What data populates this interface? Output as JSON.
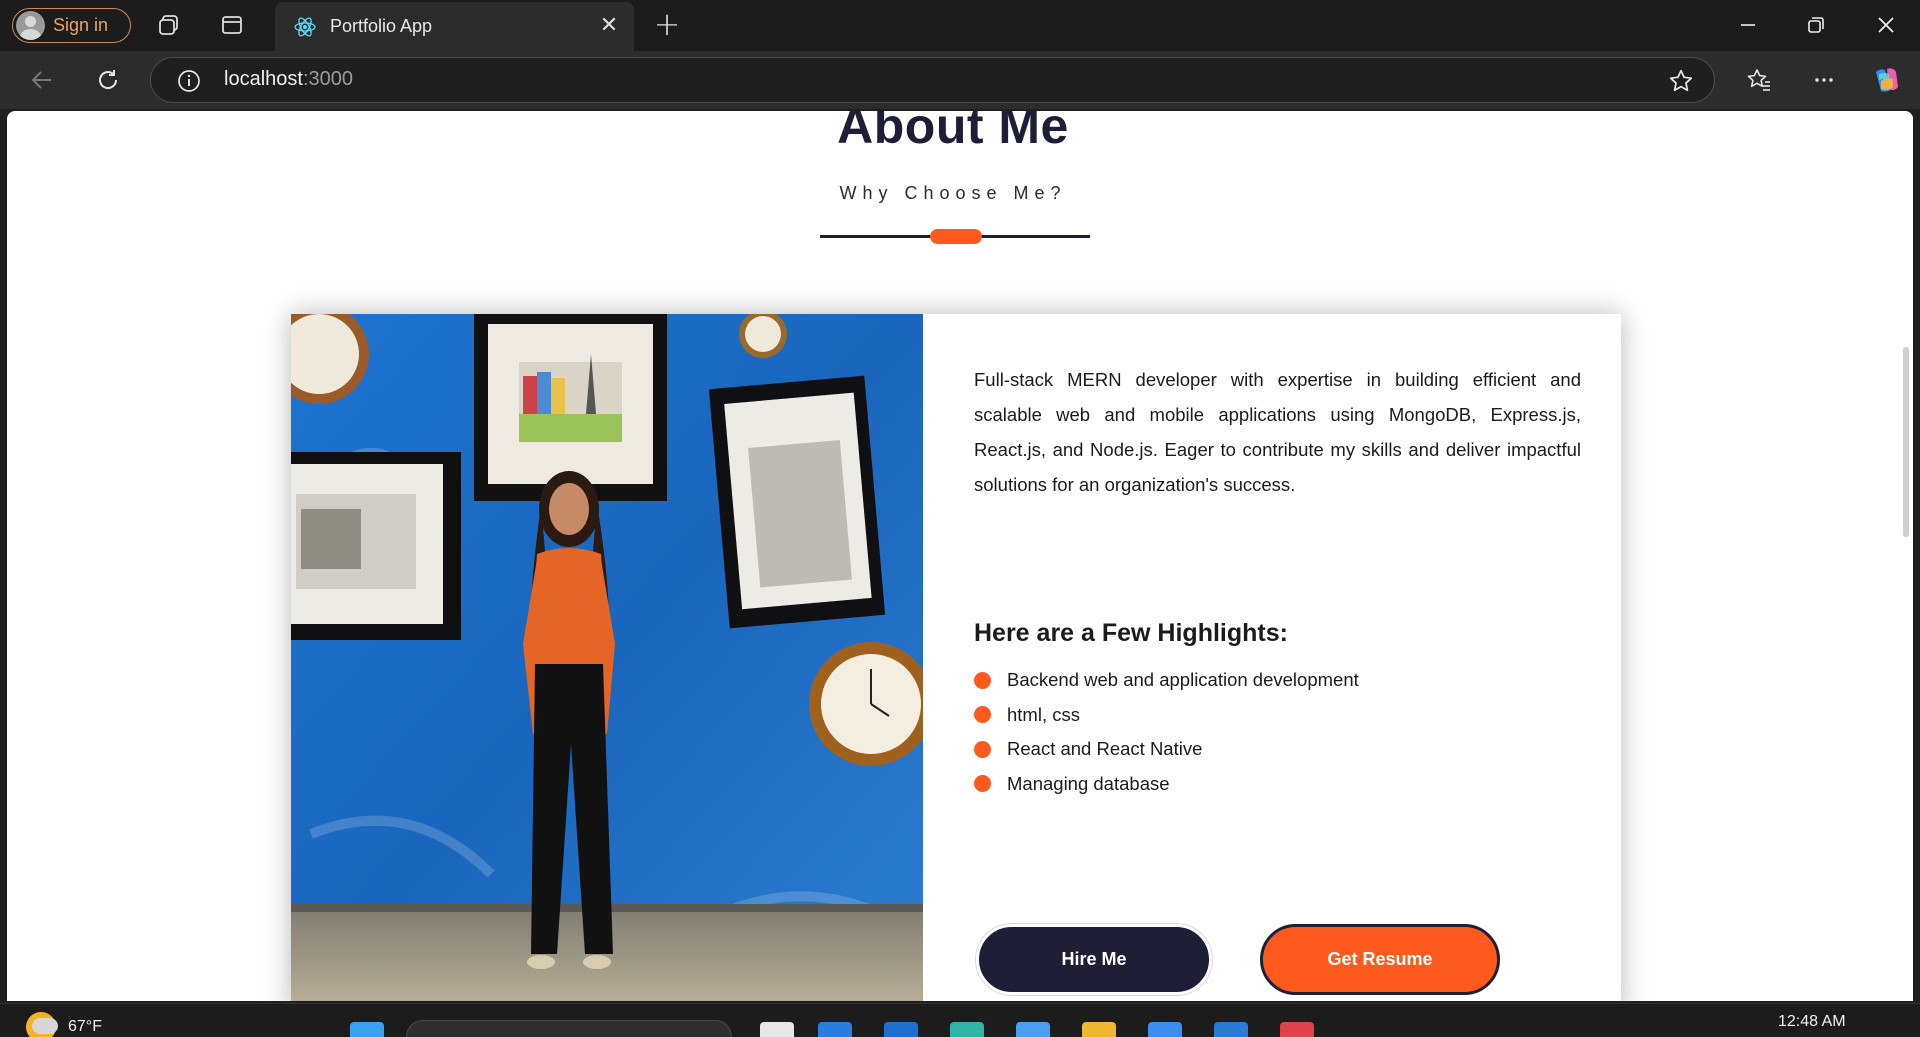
{
  "browser": {
    "signin_label": "Sign in",
    "tab_title": "Portfolio App",
    "url_host": "localhost",
    "url_port": ":3000"
  },
  "page": {
    "title": "About Me",
    "subtitle": "Why Choose Me?",
    "bio": "Full-stack MERN developer with expertise in building efficient and scalable web and mobile applications using MongoDB, Express.js, React.js, and Node.js. Eager to contribute my skills and deliver impactful solutions for an organization's success.",
    "highlights_title": "Here are a Few Highlights:",
    "highlights": [
      "Backend web and application development",
      "html, css",
      "React and React Native",
      "Managing database"
    ],
    "hire_button": "Hire Me",
    "resume_button": "Get Resume"
  },
  "taskbar": {
    "temperature": "67°F",
    "time": "12:48 AM"
  },
  "colors": {
    "accent": "#ff5a1e",
    "navy": "#1e1f36",
    "photo_wall": "#1e6fc6"
  }
}
